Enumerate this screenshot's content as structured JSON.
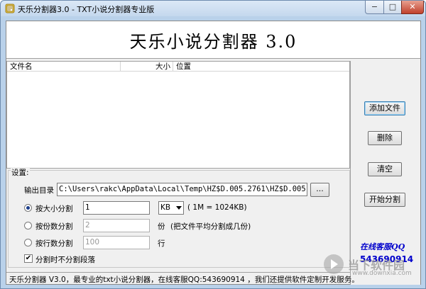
{
  "window": {
    "title": "天乐分割器3.0 - TXT小说分割器专业版",
    "controls": {
      "minimize": "−",
      "maximize": "□",
      "close": "✕"
    }
  },
  "banner": {
    "title": "天乐小说分割器 3.0"
  },
  "file_list": {
    "columns": [
      "文件名",
      "大小",
      "位置"
    ],
    "rows": []
  },
  "buttons": {
    "add_file": "添加文件",
    "delete": "删除",
    "clear": "清空",
    "start_split": "开始分割"
  },
  "support": {
    "label": "在线客服QQ",
    "qq": "543690914"
  },
  "settings": {
    "legend": "设置:",
    "output_dir_label": "输出目录",
    "output_dir_value": "C:\\Users\\rakc\\AppData\\Local\\Temp\\HZ$D.005.2761\\HZ$D.005.",
    "browse_label": "...",
    "by_size": {
      "label": "按大小分割",
      "value": "1",
      "unit": "KB",
      "hint": "( 1M = 1024KB)",
      "selected": true
    },
    "by_parts": {
      "label": "按份数分割",
      "value": "2",
      "unit": "份",
      "hint": "(把文件平均分割成几份)",
      "selected": false
    },
    "by_lines": {
      "label": "按行数分割",
      "value": "100",
      "unit": "行",
      "selected": false
    },
    "no_split_paragraph": {
      "label": "分割时不分割段落",
      "checked": true,
      "mark": "✔"
    }
  },
  "status_bar": {
    "text": "天乐分割器 V3.0，最专业的txt小说分割器，在线客服QQ:543690914 ，我们还提供软件定制开发服务。"
  },
  "watermark": {
    "name": "当下软件园",
    "url": "www.downxia.com"
  },
  "colors": {
    "qq_text": "#0000cc",
    "radio_dot": "#1b3d8a",
    "close_button": "#c0412c"
  }
}
